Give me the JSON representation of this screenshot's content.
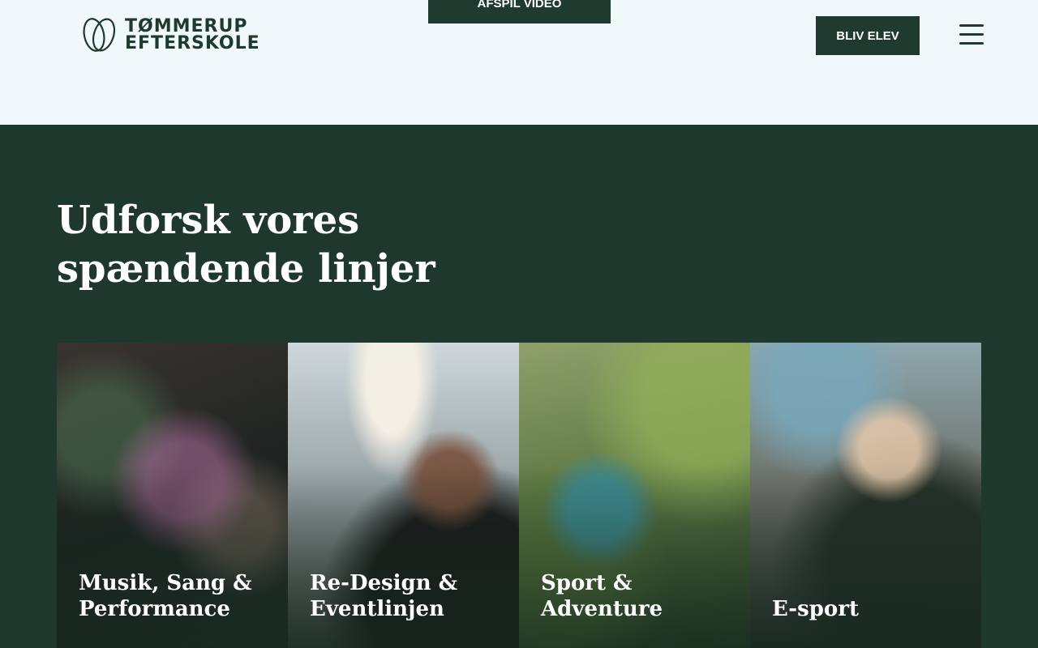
{
  "header": {
    "logo_line1": "TØMMERUP",
    "logo_line2": "EFTERSKOLE",
    "video_button": "AFSPIL VIDEO",
    "cta_button": "BLIV ELEV",
    "menu_icon": "hamburger-menu-icon"
  },
  "section": {
    "headline": "Udforsk vores spændende linjer",
    "cards": [
      {
        "label": "Musik, Sang & Performance"
      },
      {
        "label": "Re-Design & Eventlinjen"
      },
      {
        "label": "Sport & Adventure"
      },
      {
        "label": "E-sport"
      }
    ]
  },
  "colors": {
    "dark_green": "#1f382d",
    "top_bg": "#f0f8fa",
    "text_light": "#ffffff"
  }
}
